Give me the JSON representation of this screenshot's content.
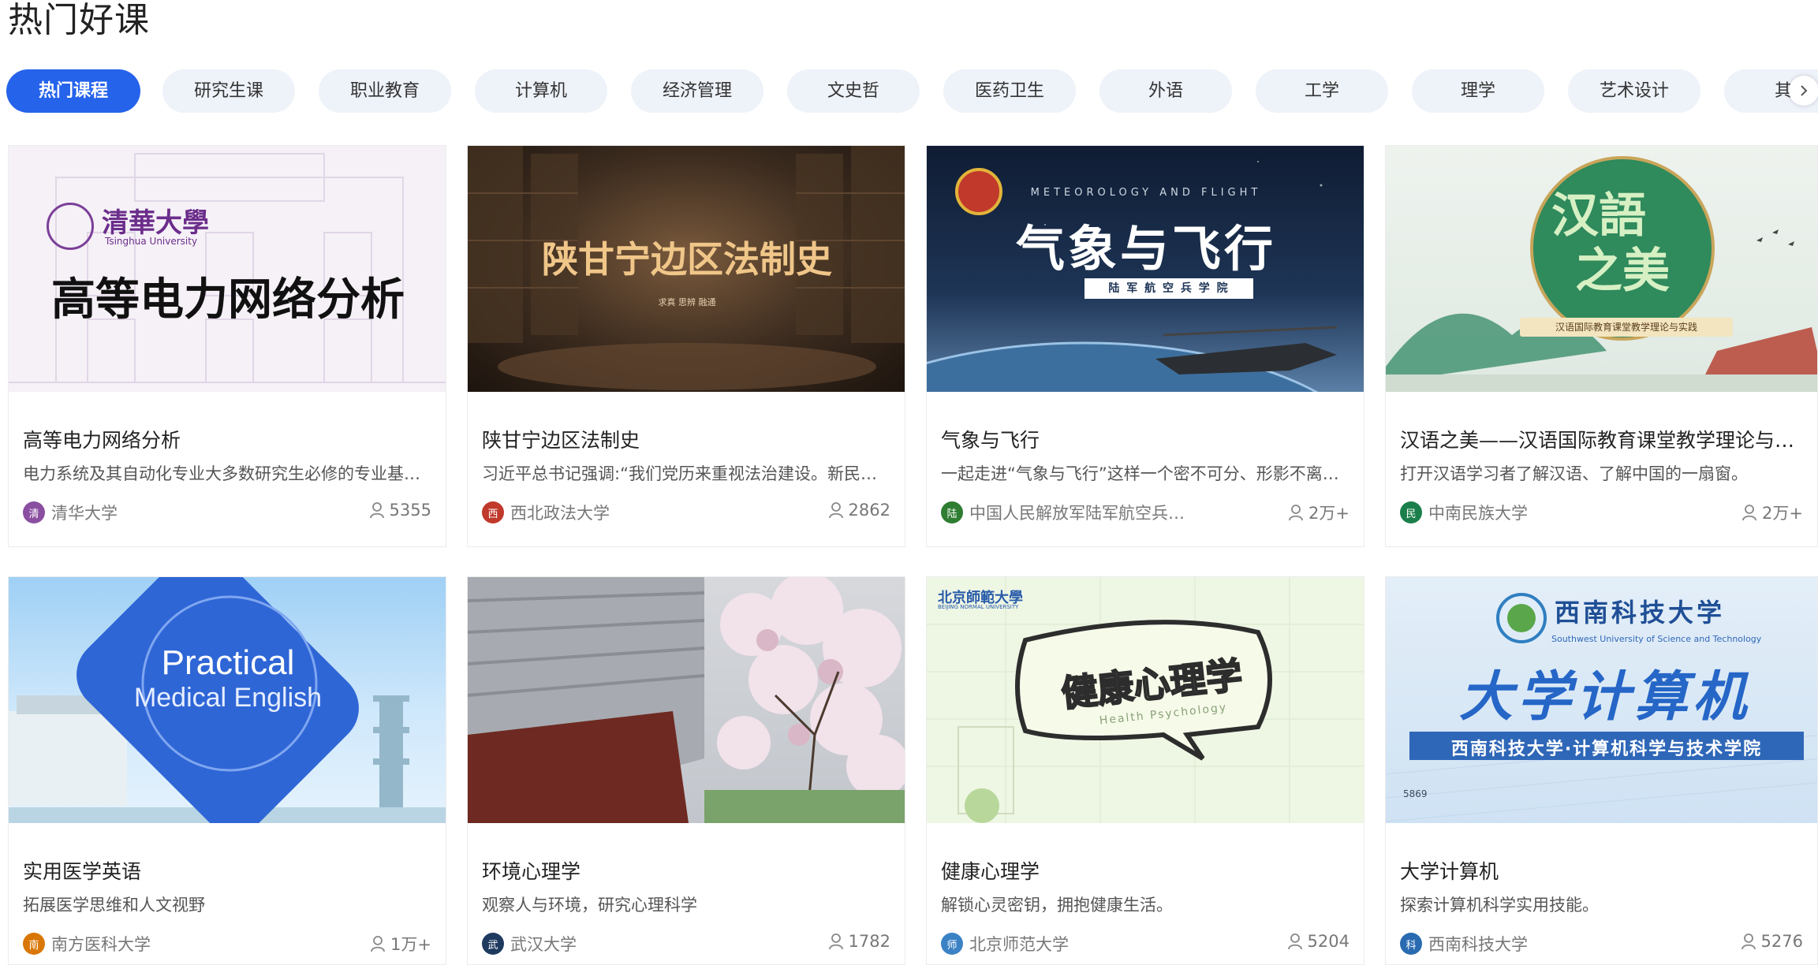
{
  "page": {
    "title": "热门好课"
  },
  "tabs": [
    {
      "label": "热门课程",
      "active": true
    },
    {
      "label": "研究生课"
    },
    {
      "label": "职业教育"
    },
    {
      "label": "计算机"
    },
    {
      "label": "经济管理"
    },
    {
      "label": "文史哲"
    },
    {
      "label": "医药卫生"
    },
    {
      "label": "外语"
    },
    {
      "label": "工学"
    },
    {
      "label": "理学"
    },
    {
      "label": "艺术设计"
    },
    {
      "label": "其"
    }
  ],
  "tabs_next_icon": "chevron-right-icon",
  "covers": {
    "c1": {
      "brand": "清華大學",
      "brand_en": "Tsinghua University",
      "headline": "高等电力网络分析"
    },
    "c2": {
      "headline": "陕甘宁边区法制史",
      "motto": "求真 思辨 融通"
    },
    "c3": {
      "top": "METEOROLOGY AND FLIGHT",
      "headline": "气象与飞行",
      "sub": "陆 军 航 空 兵 学 院"
    },
    "c4": {
      "headline_1": "汉語",
      "headline_2": "之美",
      "banner": "汉语国际教育课堂教学理论与实践"
    },
    "c5": {
      "line1": "Practical",
      "line2": "Medical English"
    },
    "c7": {
      "brand": "北京師範大學",
      "brand_en": "BEIJING NORMAL UNIVERSITY",
      "headline": "健康心理学",
      "sub": "Health Psychology"
    },
    "c8": {
      "brand": "西南科技大学",
      "brand_en": "Southwest University of Science and Technology",
      "headline": "大学计算机",
      "sub": "西南科技大学·计算机科学与技术学院",
      "code": "5869"
    }
  },
  "courses": [
    {
      "title": "高等电力网络分析",
      "desc": "电力系统及其自动化专业大多数研究生必修的专业基础课程",
      "school": "清华大学",
      "count": "5355",
      "logo_color": "#8a4fa0"
    },
    {
      "title": "陕甘宁边区法制史",
      "desc": "习近平总书记强调:“我们党历来重视法治建设。新民主主义革命时期",
      "school": "西北政法大学",
      "count": "2862",
      "logo_color": "#c0392b"
    },
    {
      "title": "气象与飞行",
      "desc": "一起走进“气象与飞行”这样一个密不可分、形影不离的世界",
      "school": "中国人民解放军陆军航空兵学院",
      "count": "2万+",
      "logo_color": "#2e7d32"
    },
    {
      "title": "汉语之美——汉语国际教育课堂教学理论与实践",
      "desc": "打开汉语学习者了解汉语、了解中国的一扇窗。",
      "school": "中南民族大学",
      "count": "2万+",
      "logo_color": "#1b7f4b"
    },
    {
      "title": "实用医学英语",
      "desc": "拓展医学思维和人文视野",
      "school": "南方医科大学",
      "count": "1万+",
      "logo_color": "#d97706"
    },
    {
      "title": "环境心理学",
      "desc": "观察人与环境，研究心理科学",
      "school": "武汉大学",
      "count": "1782",
      "logo_color": "#1e3a5f"
    },
    {
      "title": "健康心理学",
      "desc": "解锁心灵密钥，拥抱健康生活。",
      "school": "北京师范大学",
      "count": "5204",
      "logo_color": "#3b82c4"
    },
    {
      "title": "大学计算机",
      "desc": "探索计算机科学实用技能。",
      "school": "西南科技大学",
      "count": "5276",
      "logo_color": "#2a6ab0"
    }
  ]
}
